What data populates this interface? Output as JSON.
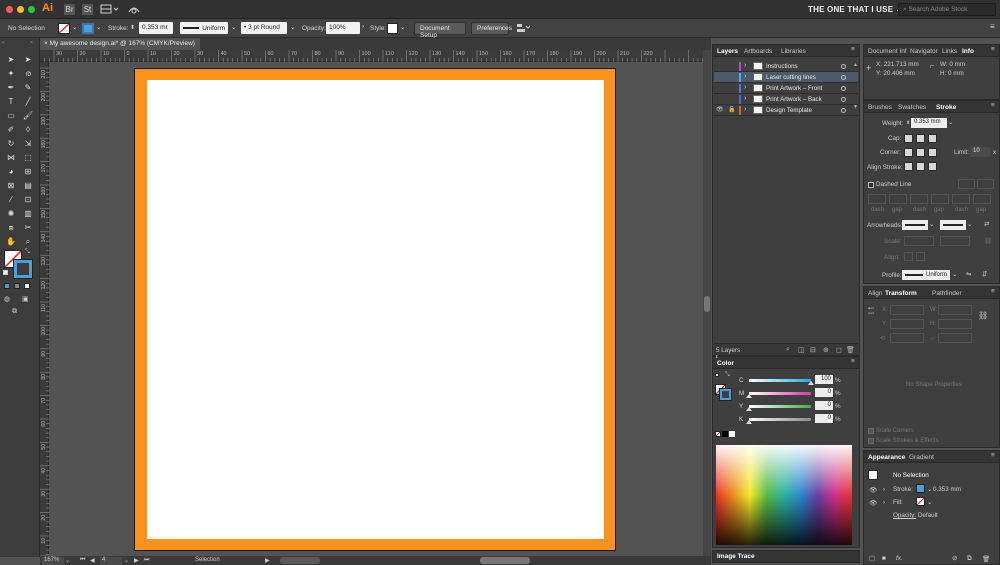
{
  "app": {
    "logo": "Ai",
    "icons": [
      "Br",
      "St"
    ],
    "workspace": "THE ONE THAT I USE",
    "workspace_caret": "⌄",
    "search_placeholder": "Search Adobe Stock"
  },
  "control_bar": {
    "selection": "No Selection",
    "stroke_label": "Stroke:",
    "stroke_value": "0.353 mr",
    "stroke_profile": "Uniform",
    "brush": "3 pt Round",
    "opacity_label": "Opacity:",
    "opacity_value": "100%",
    "style_label": "Style:",
    "document_setup": "Document Setup",
    "preferences": "Preferences"
  },
  "document": {
    "tab_title": "My awesome design.ai* @ 167% (CMYK/Preview)",
    "close": "×"
  },
  "ruler_h": [
    "30",
    "20",
    "10",
    "0",
    "10",
    "20",
    "30",
    "40",
    "50",
    "60",
    "70",
    "80",
    "90",
    "100",
    "110",
    "120",
    "130",
    "140",
    "150",
    "160",
    "170",
    "180",
    "190",
    "200",
    "210",
    "220"
  ],
  "ruler_v": [
    "210",
    "200",
    "190",
    "180",
    "170",
    "160",
    "150",
    "140",
    "130",
    "120",
    "110",
    "100",
    "90",
    "80",
    "70",
    "60",
    "50",
    "40",
    "30",
    "20",
    "10",
    "0"
  ],
  "status": {
    "zoom": "167%",
    "artboard_num": "4",
    "mode": "Selection"
  },
  "layers_panel": {
    "tabs": [
      "Layers",
      "Artboards",
      "Libraries"
    ],
    "layers": [
      {
        "name": "Instructions",
        "color": "#c640d8",
        "visible": false,
        "locked": false
      },
      {
        "name": "Laser cutting lines",
        "color": "#4ab0e6",
        "visible": false,
        "locked": false
      },
      {
        "name": "Print Artwork – Front",
        "color": "#3f7fd9",
        "visible": false,
        "locked": false
      },
      {
        "name": "Print Artwork – Back",
        "color": "#4b6ce0",
        "visible": false,
        "locked": false
      },
      {
        "name": "Design Template",
        "color": "#e0602a",
        "visible": true,
        "locked": true
      }
    ],
    "footer": "5 Layers"
  },
  "color_panel": {
    "title": "Color",
    "channels": [
      {
        "label": "C",
        "value": "100",
        "pct": "%",
        "color": "#2aa7e0",
        "fraction": 1.0
      },
      {
        "label": "M",
        "value": "0",
        "pct": "%",
        "color": "#d23ba0",
        "fraction": 0
      },
      {
        "label": "Y",
        "value": "0",
        "pct": "%",
        "color": "#3fae4a",
        "fraction": 0
      },
      {
        "label": "K",
        "value": "0",
        "pct": "%",
        "color": "#8a8a8a",
        "fraction": 0
      }
    ],
    "image_trace": "Image Trace"
  },
  "info_panel": {
    "tabs": [
      "Document Inf",
      "Navigator",
      "Links",
      "Info"
    ],
    "x": "X: 221.713 mm",
    "y": "Y: 20.406 mm",
    "w": "W: 0 mm",
    "h": "H: 0 mm"
  },
  "stroke_panel": {
    "tabs": [
      "Brushes",
      "Swatches",
      "Stroke"
    ],
    "weight_label": "Weight:",
    "weight_value": "0.353 mm",
    "cap_label": "Cap:",
    "corner_label": "Corner:",
    "limit_label": "Limit:",
    "limit_value": "10",
    "limit_unit": "x",
    "align_label": "Align Stroke:",
    "dashed_label": "Dashed Line",
    "dash_labels": [
      "dash",
      "gap",
      "dash",
      "gap",
      "dash",
      "gap"
    ],
    "arrowheads_label": "Arrowheads:",
    "scale_label": "Scale:",
    "align2_label": "Align:",
    "profile_label": "Profile:",
    "profile_value": "Uniform"
  },
  "transform_panel": {
    "tabs": [
      "Align",
      "Transform",
      "Pathfinder"
    ],
    "x": "X:",
    "y": "Y:",
    "w": "W:",
    "h": "H:",
    "empty": "No Shape Properties",
    "scale_corners": "Scale Corners",
    "scale_strokes": "Scale Strokes & Effects"
  },
  "appearance_panel": {
    "tabs": [
      "Appearance",
      "Gradient"
    ],
    "selection": "No Selection",
    "stroke_label": "Stroke:",
    "stroke_value": "0.353 mm",
    "fill_label": "Fill:",
    "opacity_label": "Opacity:",
    "opacity_value": "Default",
    "fx": "fx."
  },
  "colors": {
    "artboard_border": "#f7931e",
    "accent_blue": "#4a9fd8",
    "selected_row": "#4c5a6c"
  }
}
